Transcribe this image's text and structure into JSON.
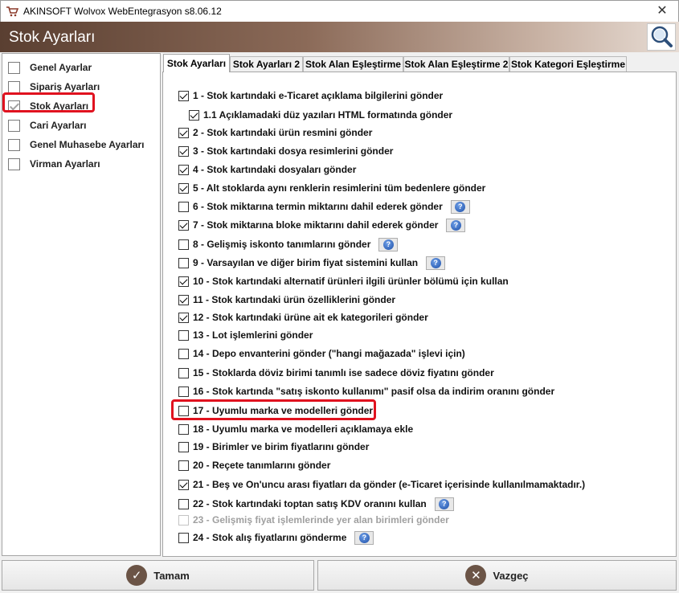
{
  "window": {
    "title": "AKINSOFT Wolvox WebEntegrasyon s8.06.12",
    "close_glyph": "✕"
  },
  "header": {
    "title": "Stok Ayarları"
  },
  "nav": [
    {
      "label": "Genel Ayarlar",
      "checked": false
    },
    {
      "label": "Sipariş Ayarları",
      "checked": false
    },
    {
      "label": "Stok Ayarları",
      "checked": true
    },
    {
      "label": "Cari Ayarları",
      "checked": false
    },
    {
      "label": "Genel Muhasebe Ayarları",
      "checked": false
    },
    {
      "label": "Virman Ayarları",
      "checked": false
    }
  ],
  "tabs": [
    {
      "label": "Stok Ayarları",
      "active": true
    },
    {
      "label": "Stok Ayarları 2",
      "active": false
    },
    {
      "label": "Stok Alan Eşleştirme",
      "active": false
    },
    {
      "label": "Stok Alan Eşleştirme 2",
      "active": false
    },
    {
      "label": "Stok Kategori Eşleştirme",
      "active": false
    }
  ],
  "options": [
    {
      "label": "1 - Stok kartındaki e-Ticaret açıklama bilgilerini gönder",
      "checked": true,
      "help": false,
      "sub": false,
      "disabled": false
    },
    {
      "label": "1.1 Açıklamadaki düz yazıları HTML formatında gönder",
      "checked": true,
      "help": false,
      "sub": true,
      "disabled": false
    },
    {
      "label": "2 - Stok kartındaki ürün resmini gönder",
      "checked": true,
      "help": false,
      "sub": false,
      "disabled": false
    },
    {
      "label": "3 - Stok kartındaki dosya resimlerini gönder",
      "checked": true,
      "help": false,
      "sub": false,
      "disabled": false
    },
    {
      "label": "4 - Stok kartındaki dosyaları gönder",
      "checked": true,
      "help": false,
      "sub": false,
      "disabled": false
    },
    {
      "label": "5 - Alt stoklarda aynı renklerin resimlerini tüm bedenlere gönder",
      "checked": true,
      "help": false,
      "sub": false,
      "disabled": false
    },
    {
      "label": "6 - Stok miktarına termin miktarını dahil ederek gönder",
      "checked": false,
      "help": true,
      "sub": false,
      "disabled": false
    },
    {
      "label": "7 - Stok miktarına bloke miktarını dahil ederek gönder",
      "checked": true,
      "help": true,
      "sub": false,
      "disabled": false
    },
    {
      "label": "8 - Gelişmiş iskonto tanımlarını gönder",
      "checked": false,
      "help": true,
      "sub": false,
      "disabled": false
    },
    {
      "label": "9 - Varsayılan ve diğer birim fiyat sistemini kullan",
      "checked": false,
      "help": true,
      "sub": false,
      "disabled": false
    },
    {
      "label": "10 - Stok kartındaki alternatif ürünleri ilgili ürünler bölümü için kullan",
      "checked": true,
      "help": false,
      "sub": false,
      "disabled": false
    },
    {
      "label": "11 - Stok kartındaki ürün özelliklerini gönder",
      "checked": true,
      "help": false,
      "sub": false,
      "disabled": false
    },
    {
      "label": "12 - Stok kartındaki ürüne ait ek kategorileri gönder",
      "checked": true,
      "help": false,
      "sub": false,
      "disabled": false
    },
    {
      "label": "13 - Lot işlemlerini gönder",
      "checked": false,
      "help": false,
      "sub": false,
      "disabled": false
    },
    {
      "label": "14 - Depo envanterini gönder (\"hangi mağazada\" işlevi için)",
      "checked": false,
      "help": false,
      "sub": false,
      "disabled": false
    },
    {
      "label": "15 - Stoklarda döviz birimi tanımlı ise sadece döviz fiyatını gönder",
      "checked": false,
      "help": false,
      "sub": false,
      "disabled": false
    },
    {
      "label": "16 - Stok kartında \"satış iskonto kullanımı\" pasif olsa da indirim oranını gönder",
      "checked": false,
      "help": false,
      "sub": false,
      "disabled": false
    },
    {
      "label": "17 - Uyumlu marka ve modelleri gönder",
      "checked": false,
      "help": false,
      "sub": false,
      "disabled": false
    },
    {
      "label": "18 - Uyumlu marka ve modelleri açıklamaya ekle",
      "checked": false,
      "help": false,
      "sub": false,
      "disabled": false
    },
    {
      "label": "19 - Birimler ve birim fiyatlarını gönder",
      "checked": false,
      "help": false,
      "sub": false,
      "disabled": false
    },
    {
      "label": "20 - Reçete tanımlarını gönder",
      "checked": false,
      "help": false,
      "sub": false,
      "disabled": false
    },
    {
      "label": "21 - Beş ve On'uncu arası fiyatları da gönder (e-Ticaret içerisinde kullanılmamaktadır.)",
      "checked": true,
      "help": false,
      "sub": false,
      "disabled": false
    },
    {
      "label": "22 - Stok kartındaki toptan satış KDV oranını kullan",
      "checked": false,
      "help": true,
      "sub": false,
      "disabled": false
    },
    {
      "label": "23 - Gelişmiş fiyat işlemlerinde yer alan birimleri gönder",
      "checked": false,
      "help": false,
      "sub": false,
      "disabled": true
    },
    {
      "label": "24 - Stok alış fiyatlarını gönderme",
      "checked": false,
      "help": true,
      "sub": false,
      "disabled": false
    }
  ],
  "buttons": {
    "ok_label": "Tamam",
    "cancel_label": "Vazgeç"
  },
  "colors": {
    "highlight": "#e0121f",
    "header_dark": "#5a3f31",
    "button_icon": "#6b5446"
  }
}
